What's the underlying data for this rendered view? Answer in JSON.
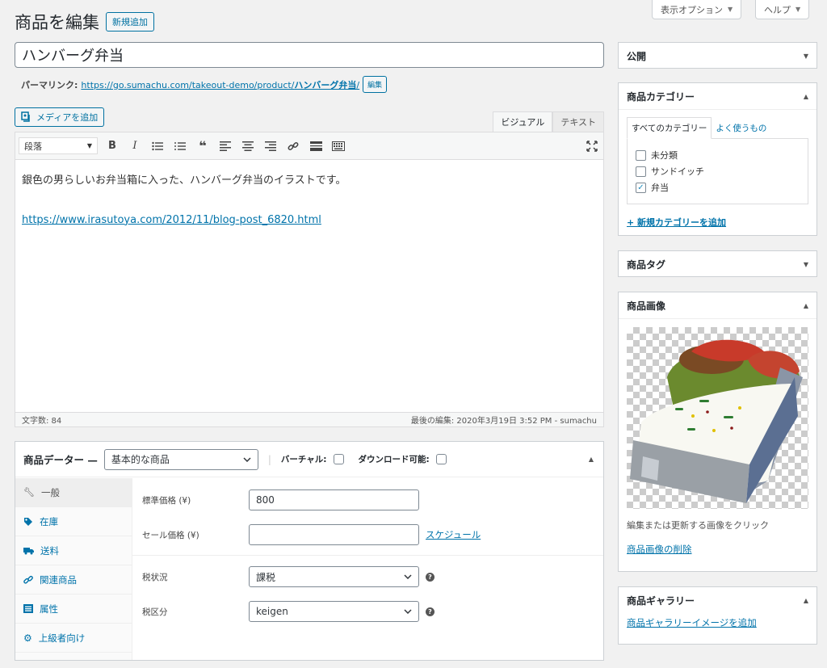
{
  "screen": {
    "display_options": "表示オプション",
    "help": "ヘルプ"
  },
  "header": {
    "title": "商品を編集",
    "add_new": "新規追加"
  },
  "post": {
    "title": "ハンバーグ弁当",
    "permalink_label": "パーマリンク:",
    "permalink_base": "https://go.sumachu.com/takeout-demo/product/",
    "permalink_slug": "ハンバーグ弁当",
    "permalink_end": "/",
    "edit_label": "編集"
  },
  "editor": {
    "add_media": "メディアを追加",
    "tab_visual": "ビジュアル",
    "tab_text": "テキスト",
    "format": "段落",
    "content_line1": "銀色の男らしいお弁当箱に入った、ハンバーグ弁当のイラストです。",
    "content_link": "https://www.irasutoya.com/2012/11/blog-post_6820.html",
    "word_count": "文字数: 84",
    "last_edit": "最後の編集: 2020年3月19日 3:52 PM - sumachu"
  },
  "product_data": {
    "label": "商品データー —",
    "type": "基本的な商品",
    "virtual": "バーチャル:",
    "downloadable": "ダウンロード可能:",
    "nav": [
      {
        "label": "一般",
        "icon": "wrench-icon"
      },
      {
        "label": "在庫",
        "icon": "tag-icon"
      },
      {
        "label": "送料",
        "icon": "truck-icon"
      },
      {
        "label": "関連商品",
        "icon": "link-icon"
      },
      {
        "label": "属性",
        "icon": "list-icon"
      },
      {
        "label": "上級者向け",
        "icon": "gear-icon"
      }
    ],
    "regular_price_label": "標準価格 (¥)",
    "regular_price": "800",
    "sale_price_label": "セール価格 (¥)",
    "sale_price": "",
    "schedule": "スケジュール",
    "tax_status_label": "税状況",
    "tax_status": "課税",
    "tax_class_label": "税区分",
    "tax_class": "keigen"
  },
  "sidebar": {
    "publish": "公開",
    "categories": {
      "title": "商品カテゴリー",
      "tab_all": "すべてのカテゴリー",
      "tab_popular": "よく使うもの",
      "items": [
        {
          "label": "未分類",
          "checked": false
        },
        {
          "label": "サンドイッチ",
          "checked": false
        },
        {
          "label": "弁当",
          "checked": true
        }
      ],
      "add_new": "+ 新規カテゴリーを追加"
    },
    "tags": "商品タグ",
    "image": {
      "title": "商品画像",
      "hint": "編集または更新する画像をクリック",
      "remove": "商品画像の削除"
    },
    "gallery": {
      "title": "商品ギャラリー",
      "add": "商品ギャラリーイメージを追加"
    }
  }
}
